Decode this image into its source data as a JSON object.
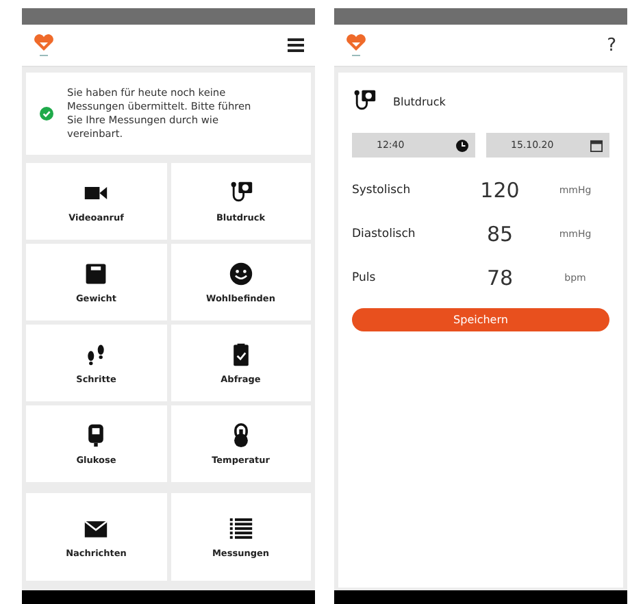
{
  "home": {
    "notice": {
      "text": "Sie haben für heute noch keine Messungen übermittelt. Bitte führen Sie Ihre Messungen durch wie vereinbart."
    },
    "tiles": [
      {
        "kind": "video",
        "label": "Videoanruf"
      },
      {
        "kind": "pressure",
        "label": "Blutdruck"
      },
      {
        "kind": "scale",
        "label": "Gewicht"
      },
      {
        "kind": "smile",
        "label": "Wohlbefinden"
      },
      {
        "kind": "steps",
        "label": "Schritte"
      },
      {
        "kind": "clipboard",
        "label": "Abfrage"
      },
      {
        "kind": "glucose",
        "label": "Glukose"
      },
      {
        "kind": "thermo",
        "label": "Temperatur"
      }
    ],
    "bottom_tiles": [
      {
        "kind": "mail",
        "label": "Nachrichten"
      },
      {
        "kind": "list",
        "label": "Messungen"
      }
    ]
  },
  "detail": {
    "help": "?",
    "title": "Blutdruck",
    "time": "12:40",
    "date": "15.10.20",
    "rows": [
      {
        "label": "Systolisch",
        "value": "120",
        "unit": "mmHg"
      },
      {
        "label": "Diastolisch",
        "value": "85",
        "unit": "mmHg"
      },
      {
        "label": "Puls",
        "value": "78",
        "unit": "bpm"
      }
    ],
    "save": "Speichern"
  }
}
